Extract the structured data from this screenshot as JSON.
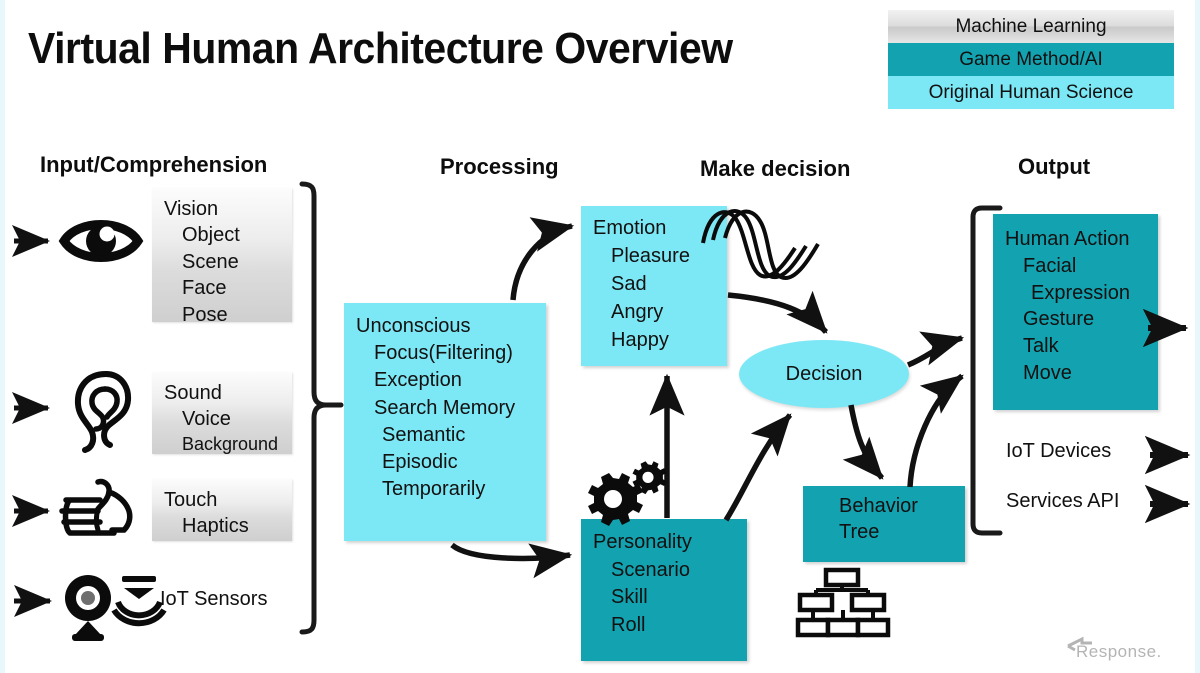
{
  "title": "Virtual Human Architecture Overview",
  "legend": {
    "items": [
      {
        "label": "Machine Learning",
        "color": "#dcdcdc",
        "key": "machine-learning"
      },
      {
        "label": "Game Method/AI",
        "color": "#13a3b0",
        "key": "game-method-ai"
      },
      {
        "label": "Original Human Science",
        "color": "#7de8f5",
        "key": "original-human-science"
      }
    ]
  },
  "headers": {
    "input": "Input/Comprehension",
    "processing": "Processing",
    "decision": "Make decision",
    "output": "Output"
  },
  "input": {
    "vision": {
      "title": "Vision",
      "items": [
        "Object",
        "Scene",
        "Face",
        "Pose"
      ]
    },
    "sound": {
      "title": "Sound",
      "items": [
        "Voice",
        "Background"
      ]
    },
    "touch": {
      "title": "Touch",
      "items": [
        "Haptics"
      ]
    },
    "iot_sensors": "IoT Sensors"
  },
  "processing": {
    "unconscious": {
      "title": "Unconscious",
      "items": [
        "Focus(Filtering)",
        "Exception",
        "Search Memory"
      ],
      "subitems": [
        "Semantic",
        "Episodic",
        "Temporarily"
      ]
    },
    "emotion": {
      "title": "Emotion",
      "items": [
        "Pleasure",
        "Sad",
        "Angry",
        "Happy"
      ]
    },
    "personality": {
      "title": "Personality",
      "items": [
        "Scenario",
        "Skill",
        "Roll"
      ]
    }
  },
  "decision": {
    "node": "Decision",
    "behavior_tree": {
      "line1": "Behavior",
      "line2": "Tree"
    }
  },
  "output": {
    "human_action": {
      "title": "Human Action",
      "items": [
        "Facial",
        "Expression",
        "Gesture",
        "Talk",
        "Move"
      ]
    },
    "iot_devices": "IoT Devices",
    "services_api": "Services API"
  },
  "watermark": "Response.",
  "colors": {
    "teal": "#13a3b0",
    "cyan": "#7de8f5",
    "gray": "#dcdcdc",
    "ink": "#111111"
  }
}
